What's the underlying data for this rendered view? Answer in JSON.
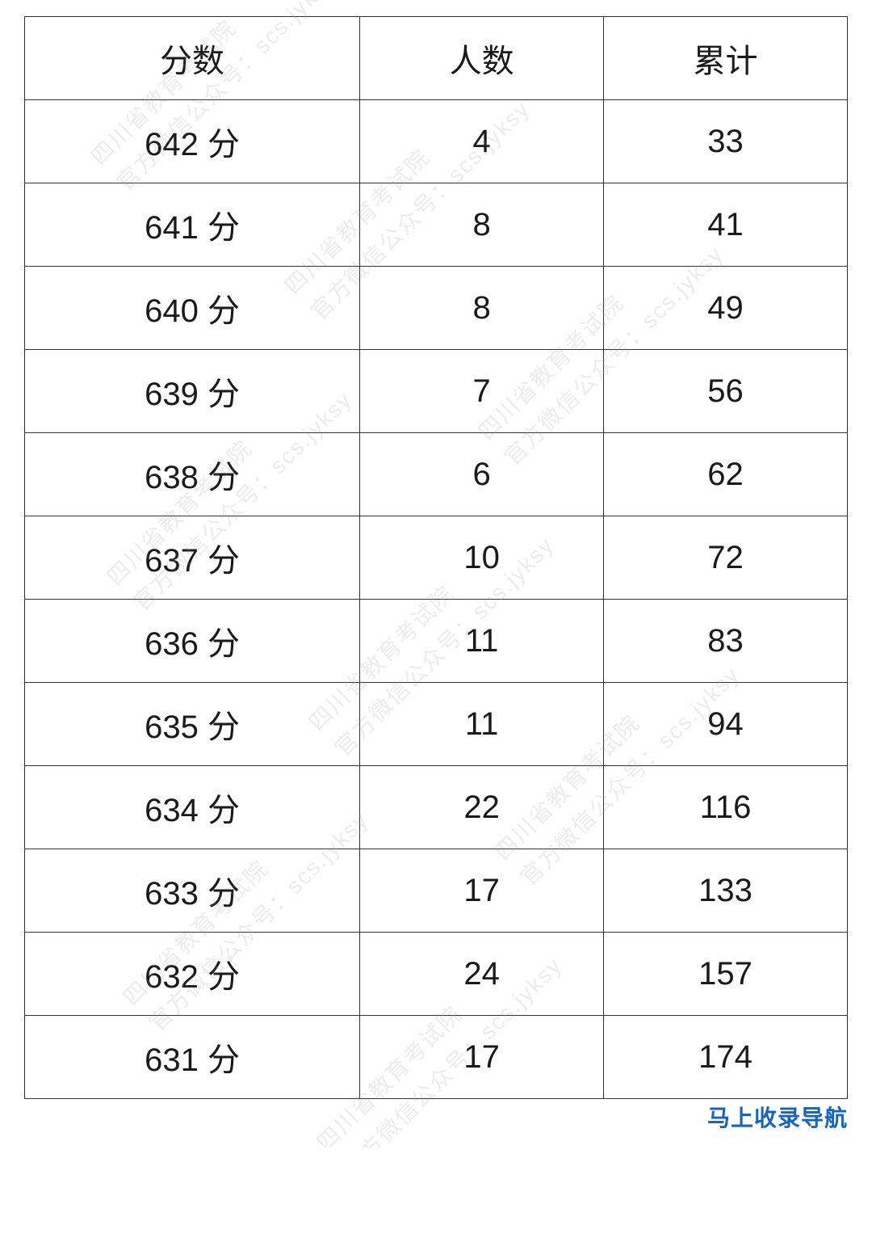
{
  "table": {
    "headers": [
      "分数",
      "人数",
      "累计"
    ],
    "rows": [
      {
        "score": "642 分",
        "count": "4",
        "cumulative": "33"
      },
      {
        "score": "641 分",
        "count": "8",
        "cumulative": "41"
      },
      {
        "score": "640 分",
        "count": "8",
        "cumulative": "49"
      },
      {
        "score": "639 分",
        "count": "7",
        "cumulative": "56"
      },
      {
        "score": "638 分",
        "count": "6",
        "cumulative": "62"
      },
      {
        "score": "637 分",
        "count": "10",
        "cumulative": "72"
      },
      {
        "score": "636 分",
        "count": "11",
        "cumulative": "83"
      },
      {
        "score": "635 分",
        "count": "11",
        "cumulative": "94"
      },
      {
        "score": "634 分",
        "count": "22",
        "cumulative": "116"
      },
      {
        "score": "633 分",
        "count": "17",
        "cumulative": "133"
      },
      {
        "score": "632 分",
        "count": "24",
        "cumulative": "157"
      },
      {
        "score": "631 分",
        "count": "17",
        "cumulative": "174"
      }
    ]
  },
  "footer": {
    "link_text": "马上收录导航"
  },
  "watermark": {
    "lines": [
      "四川省教育考试院",
      "官方微信公众号：scs.jyksy"
    ]
  }
}
